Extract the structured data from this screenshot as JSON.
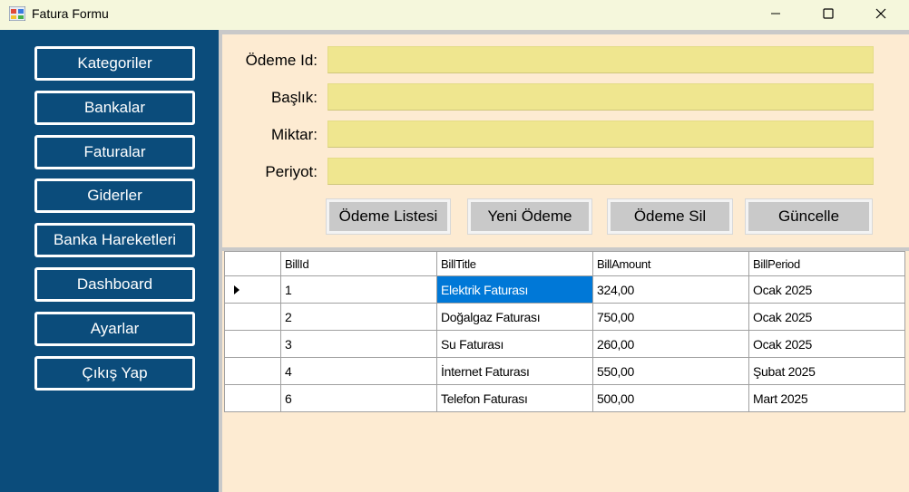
{
  "window": {
    "title": "Fatura Formu",
    "min_icon": "minimize-icon",
    "max_icon": "maximize-icon",
    "close_icon": "close-icon"
  },
  "sidebar": {
    "items": [
      {
        "label": "Kategoriler"
      },
      {
        "label": "Bankalar"
      },
      {
        "label": "Faturalar"
      },
      {
        "label": "Giderler"
      },
      {
        "label": "Banka Hareketleri"
      },
      {
        "label": "Dashboard"
      },
      {
        "label": "Ayarlar"
      },
      {
        "label": "Çıkış Yap"
      }
    ]
  },
  "form": {
    "fields": [
      {
        "label": "Ödeme Id:",
        "value": ""
      },
      {
        "label": "Başlık:",
        "value": ""
      },
      {
        "label": "Miktar:",
        "value": ""
      },
      {
        "label": "Periyot:",
        "value": ""
      }
    ],
    "buttons": {
      "list": "Ödeme Listesi",
      "new": "Yeni Ödeme",
      "delete": "Ödeme Sil",
      "update": "Güncelle"
    }
  },
  "grid": {
    "columns": [
      "BillId",
      "BillTitle",
      "BillAmount",
      "BillPeriod"
    ],
    "rows": [
      [
        "1",
        "Elektrik Faturası",
        "324,00",
        "Ocak 2025"
      ],
      [
        "2",
        "Doğalgaz Faturası",
        "750,00",
        "Ocak 2025"
      ],
      [
        "3",
        "Su Faturası",
        "260,00",
        "Ocak 2025"
      ],
      [
        "4",
        "İnternet Faturası",
        "550,00",
        "Şubat 2025"
      ],
      [
        "6",
        "Telefon Faturası",
        "500,00",
        "Mart 2025"
      ]
    ]
  },
  "colors": {
    "sidebar": "#0b4c7b",
    "form_bg": "#fdebd2",
    "input_bg": "#efe68f",
    "button_bg": "#c9c9c9",
    "selection": "#0078d7"
  }
}
